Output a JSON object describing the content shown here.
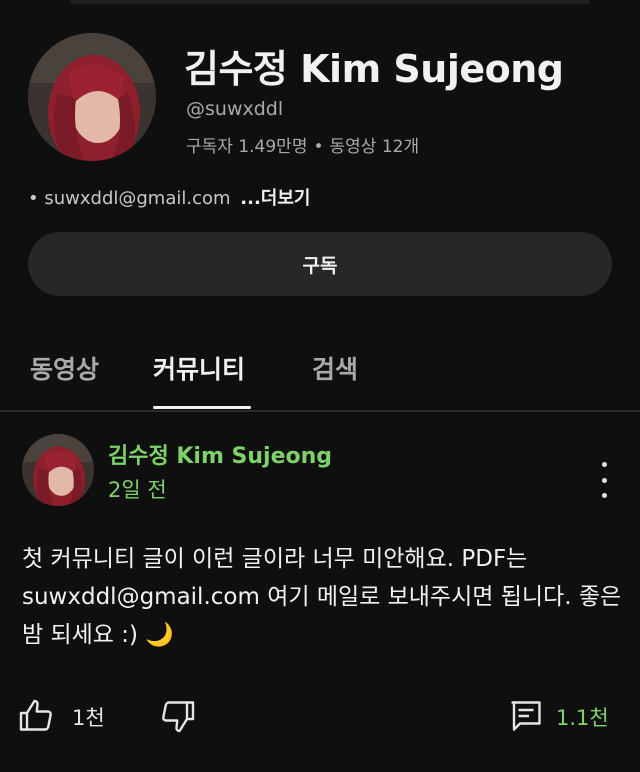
{
  "channel": {
    "title": "김수정 Kim Sujeong",
    "handle": "@suwxddl",
    "subscribers": "구독자 1.49만명",
    "separator": "•",
    "videos": "동영상 12개",
    "description_bullet": "•",
    "description": "suwxddl@gmail.com",
    "more_label": "...더보기",
    "subscribe_label": "구독"
  },
  "tabs": [
    {
      "label": "동영상",
      "active": false
    },
    {
      "label": "커뮤니티",
      "active": true
    },
    {
      "label": "검색",
      "active": false
    }
  ],
  "post": {
    "author": "김수정 Kim Sujeong",
    "time": "2일 전",
    "text": "첫 커뮤니티 글이 이런 글이라 너무 미안해요. PDF는 suwxddl@gmail.com 여기 메일로 보내주시면 됩니다. 좋은 밤 되세요 :)",
    "emoji": "🌙",
    "likes": "1천",
    "comments": "1.1천"
  },
  "colors": {
    "background": "#0f0f0f",
    "accent_green": "#7dd36a",
    "button_bg": "#272727"
  },
  "icons": [
    "thumbs-up-icon",
    "thumbs-down-icon",
    "comment-icon",
    "more-vert-icon"
  ]
}
